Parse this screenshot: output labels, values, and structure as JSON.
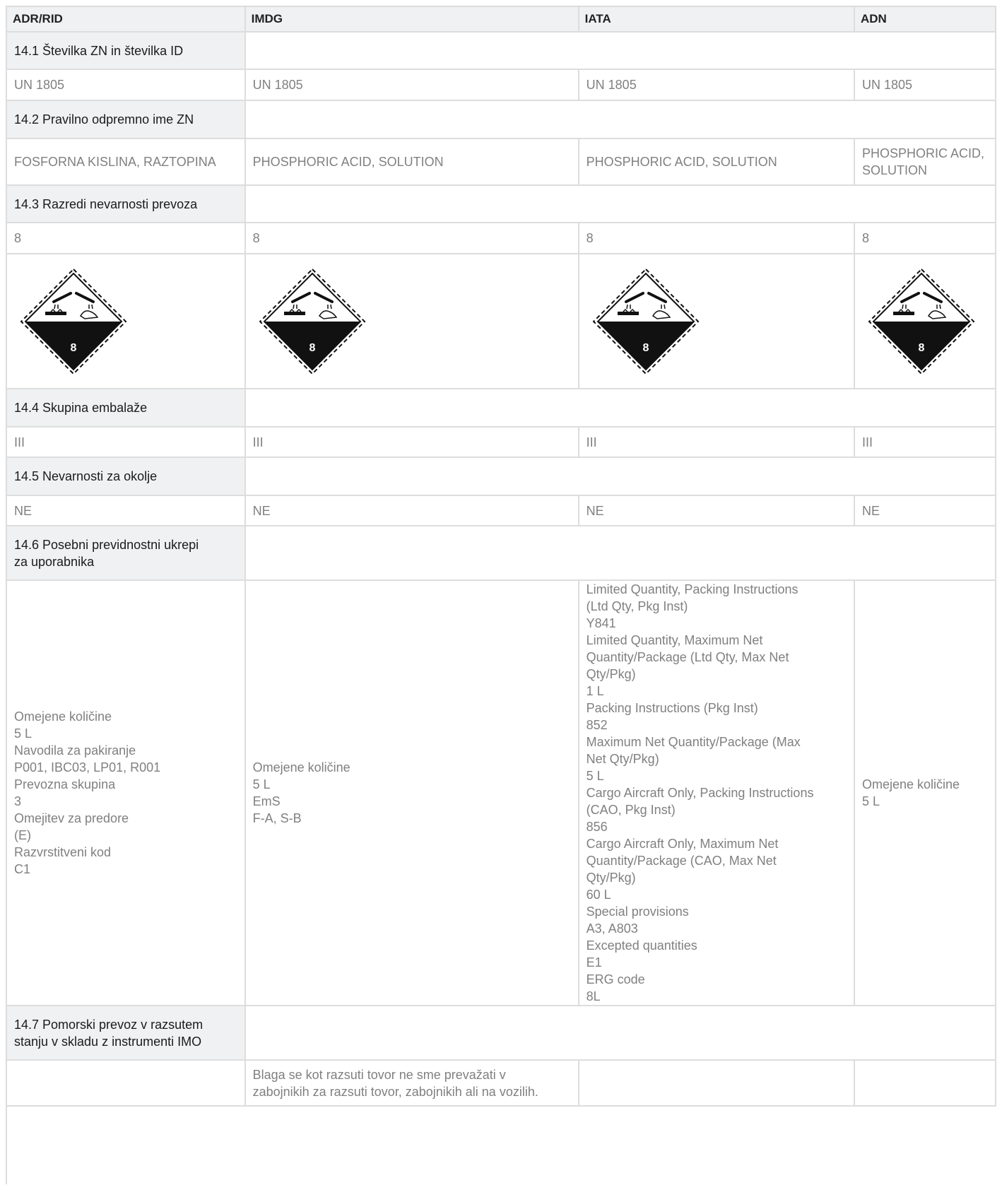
{
  "headers": [
    "ADR/RID",
    "IMDG",
    "IATA",
    "ADN"
  ],
  "sections": {
    "s1": "14.1 Številka ZN in številka ID",
    "s2": "14.2 Pravilno odpremno ime ZN",
    "s3": "14.3 Razredi nevarnosti prevoza",
    "s4": "14.4 Skupina embalaže",
    "s5": "14.5 Nevarnosti za okolje",
    "s6": [
      "14.6 Posebni previdnostni ukrepi",
      "za uporabnika"
    ],
    "s7": [
      "14.7 Pomorski prevoz v razsutem",
      "stanju v skladu z instrumenti IMO"
    ]
  },
  "un_number": [
    "UN 1805",
    "UN 1805",
    "UN 1805",
    "UN 1805"
  ],
  "shipping_name": {
    "adr": "FOSFORNA KISLINA, RAZTOPINA",
    "imdg": "PHOSPHORIC ACID, SOLUTION",
    "iata": "PHOSPHORIC ACID, SOLUTION",
    "adn": [
      "PHOSPHORIC ACID,",
      "SOLUTION"
    ]
  },
  "hazard_class": [
    "8",
    "8",
    "8",
    "8"
  ],
  "pictogram_label": "8",
  "packing_group": [
    "III",
    "III",
    "III",
    "III"
  ],
  "environment": [
    "NE",
    "NE",
    "NE",
    "NE"
  ],
  "precautions": {
    "adr": [
      "Omejene količine",
      "5 L",
      "Navodila za pakiranje",
      "P001, IBC03, LP01, R001",
      "Prevozna skupina",
      "3",
      "Omejitev za predore",
      "(E)",
      "Razvrstitveni kod",
      "C1"
    ],
    "imdg": [
      "Omejene količine",
      "5 L",
      "EmS",
      "F-A, S-B"
    ],
    "iata": [
      "Limited Quantity, Packing Instructions",
      "(Ltd Qty, Pkg Inst)",
      "Y841",
      "Limited Quantity, Maximum Net",
      "Quantity/Package (Ltd Qty, Max Net",
      "Qty/Pkg)",
      "1 L",
      "Packing Instructions (Pkg Inst)",
      "852",
      "Maximum Net Quantity/Package (Max",
      "Net Qty/Pkg)",
      "5 L",
      "Cargo Aircraft Only, Packing Instructions",
      "(CAO, Pkg Inst)",
      "856",
      "Cargo Aircraft Only, Maximum Net",
      "Quantity/Package (CAO, Max Net",
      "Qty/Pkg)",
      "60 L",
      "Special provisions",
      "A3, A803",
      "Excepted quantities",
      "E1",
      "ERG code",
      "8L"
    ],
    "adn": [
      "Omejene količine",
      "5 L"
    ]
  },
  "imo_bulk": {
    "imdg": [
      "Blaga se kot razsuti tovor ne sme prevažati v",
      "zabojnikih za razsuti tovor, zabojnikih ali na vozilih."
    ]
  }
}
